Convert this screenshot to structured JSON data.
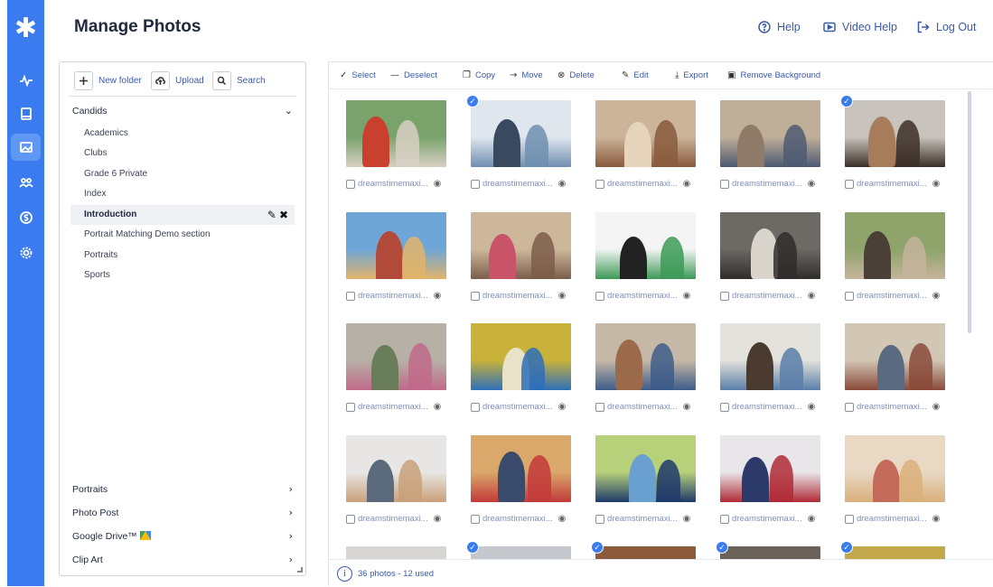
{
  "app": {
    "title": "Manage Photos",
    "header_links": [
      {
        "label": "Help",
        "icon": "help-circle-icon"
      },
      {
        "label": "Video Help",
        "icon": "video-icon"
      },
      {
        "label": "Log Out",
        "icon": "logout-icon"
      }
    ]
  },
  "rail": {
    "logo": "✱",
    "items": [
      "activity-icon",
      "book-icon",
      "photos-icon",
      "people-icon",
      "dollar-icon",
      "settings-icon"
    ],
    "active_index": 2
  },
  "folder_toolbar": {
    "new_folder": "New folder",
    "upload": "Upload",
    "search": "Search"
  },
  "folders": {
    "group": "Candids",
    "items": [
      "Academics",
      "Clubs",
      "Grade 6 Private",
      "Index",
      "Introduction",
      "Portrait Matching Demo section",
      "Portraits",
      "Sports"
    ],
    "selected": "Introduction",
    "sections": [
      "Portraits",
      "Photo Post",
      "Google Drive™",
      "Clip Art"
    ]
  },
  "photo_toolbar": {
    "select": "Select",
    "deselect": "Deselect",
    "copy": "Copy",
    "move": "Move",
    "delete": "Delete",
    "edit": "Edit",
    "export": "Export",
    "remove_background": "Remove Background"
  },
  "photo_caption": "dreamstimemaxi...",
  "photo_caption_alt": "dreamstimemaxi...",
  "footer": {
    "summary": "36 photos - 12 used"
  },
  "colors": {
    "accent": "#3a7cf0",
    "link": "#3a5aa8"
  }
}
